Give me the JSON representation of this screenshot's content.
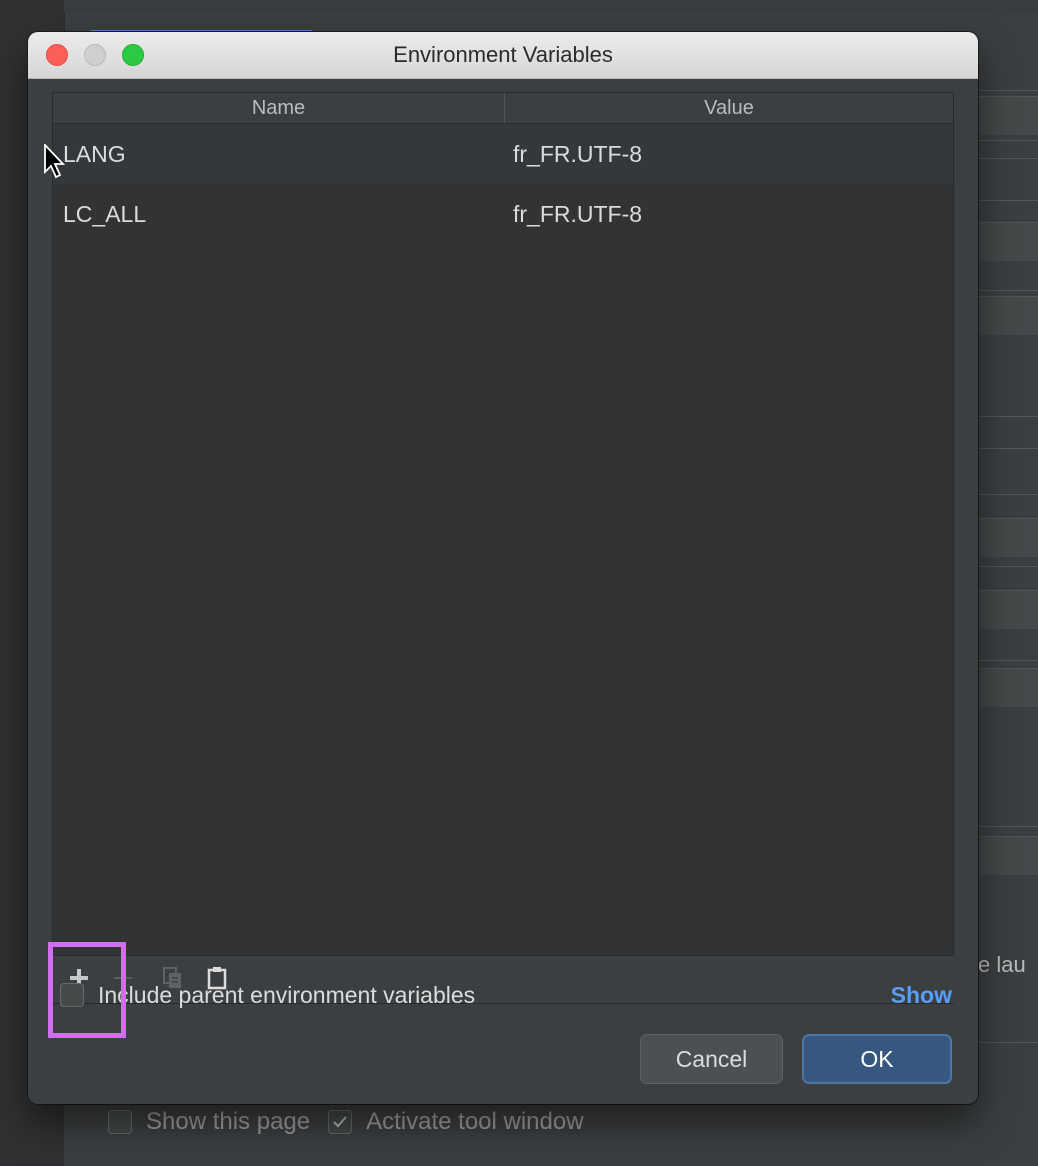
{
  "dialog": {
    "title": "Environment Variables",
    "table": {
      "columns": [
        "Name",
        "Value"
      ],
      "rows": [
        {
          "name": "LANG",
          "value": "fr_FR.UTF-8"
        },
        {
          "name": "LC_ALL",
          "value": "fr_FR.UTF-8"
        }
      ]
    },
    "toolbar": {
      "add_icon": "plus-icon",
      "remove_icon": "minus-icon",
      "copy_icon": "copy-icon",
      "paste_icon": "paste-icon"
    },
    "include_parent_label": "Include parent environment variables",
    "include_parent_checked": false,
    "show_link": "Show",
    "cancel_label": "Cancel",
    "ok_label": "OK"
  },
  "background": {
    "right_text": "e lau",
    "show_page_label": "Show this page",
    "activate_tool_window_label": "Activate tool window",
    "activate_tool_window_checked": true
  },
  "colors": {
    "accent": "#4a88c7",
    "link": "#589df6",
    "highlight": "#d06ef0"
  }
}
